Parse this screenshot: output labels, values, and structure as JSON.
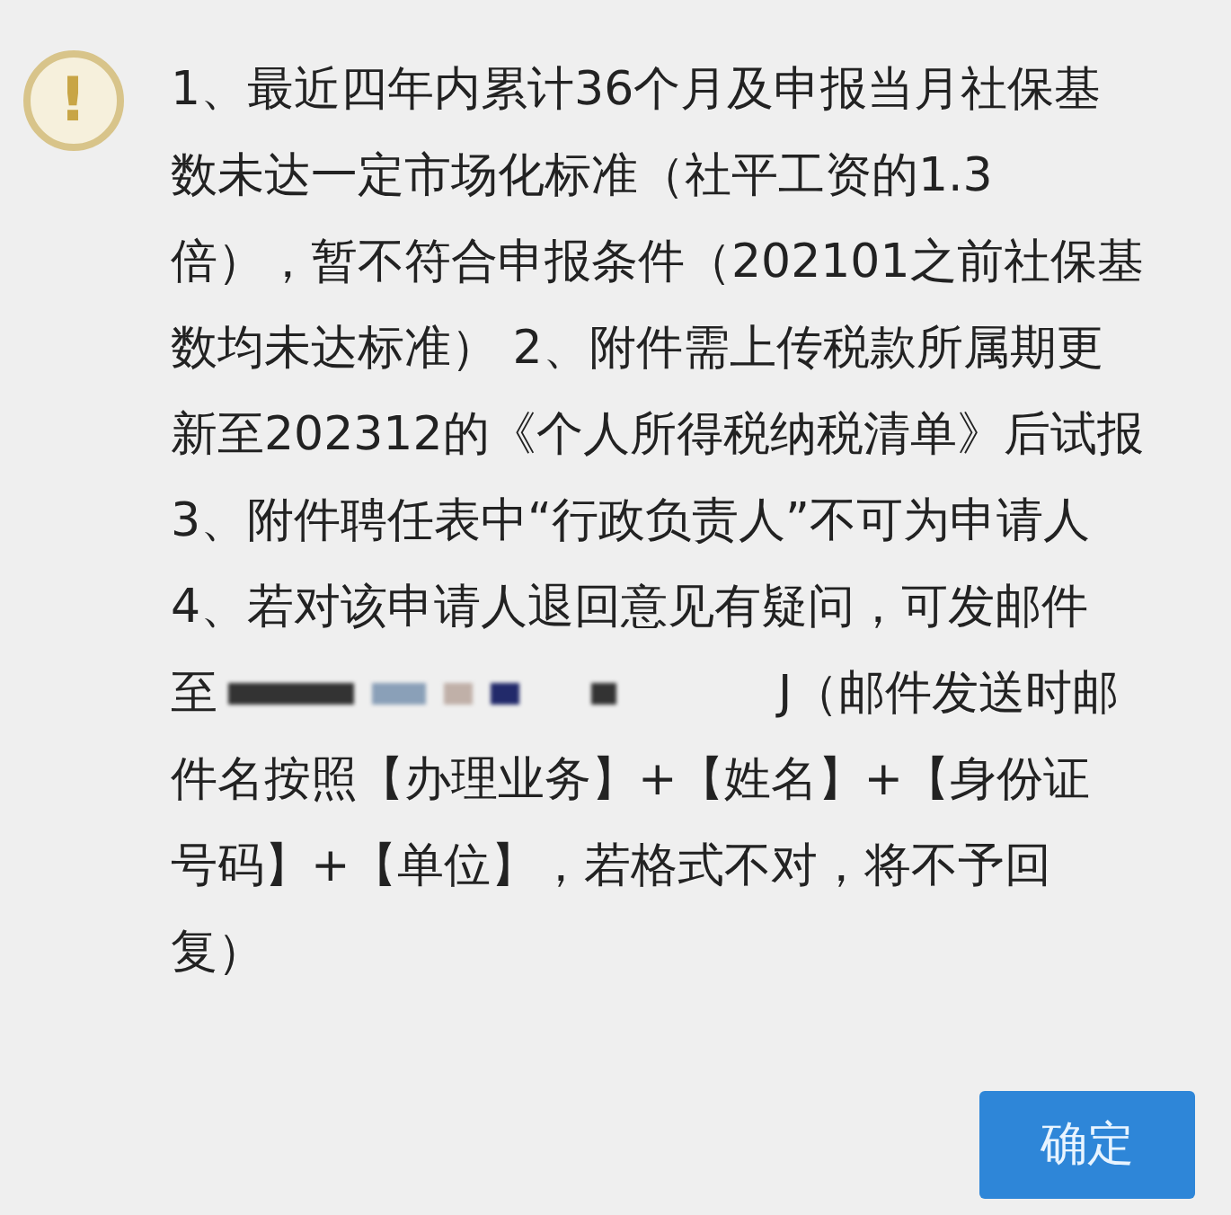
{
  "dialog": {
    "icon": "!",
    "message_lines": [
      {
        "text": "1、最近四年内累计36个月及申报当月社保基"
      },
      {
        "text": "数未达一定市场化标准（社平工资的1.3"
      },
      {
        "text": "倍），暂不符合申报条件（202101之前社保基"
      },
      {
        "text": "数均未达标准） 2、附件需上传税款所属期更"
      },
      {
        "text": "新至202312的《个人所得税纳税清单》后试报"
      },
      {
        "text": "3、附件聘任表中“行政负责人”不可为申请人"
      },
      {
        "text": "4、若对该申请人退回意见有疑问，可发邮件"
      },
      {
        "kind": "redacted",
        "before": "至",
        "after": "J（邮件发送时邮"
      },
      {
        "text": "件名按照【办理业务】+【姓名】+【身份证"
      },
      {
        "text": "号码】+【单位】，若格式不对，将不予回"
      },
      {
        "text": "复）"
      }
    ],
    "buttons": [
      {
        "label": "确定"
      }
    ]
  }
}
